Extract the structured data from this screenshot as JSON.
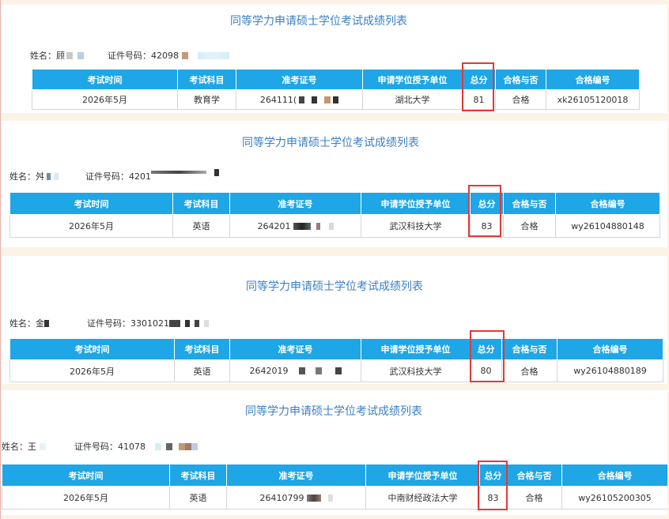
{
  "header": [
    "考试时间",
    "考试科目",
    "准考证号",
    "申请学位授予单位",
    "总分",
    "合格与否",
    "合格编号"
  ],
  "name_label": "姓名：",
  "cert_label": "证件号码：",
  "records": [
    {
      "title": "同等学力申请硕士学位考试成绩列表",
      "name_visible": "顾",
      "cert_visible": "42098",
      "exam_time": "2026年5月",
      "subject": "教育学",
      "ticket_visible": "264111(",
      "unit": "湖北大学",
      "score": "81",
      "result": "合格",
      "cert_no": "xk26105120018"
    },
    {
      "title": "同等学力申请硕士学位考试成绩列表",
      "name_visible": "舛",
      "cert_visible": "4201",
      "exam_time": "2026年5月",
      "subject": "英语",
      "ticket_visible": "264201",
      "unit": "武汉科技大学",
      "score": "83",
      "result": "合格",
      "cert_no": "wy26104880148"
    },
    {
      "title": "同等学力申请硕士学位考试成绩列表",
      "name_visible": "金",
      "cert_visible": "3301021",
      "exam_time": "2026年5月",
      "subject": "英语",
      "ticket_visible": "2642019",
      "unit": "武汉科技大学",
      "score": "80",
      "result": "合格",
      "cert_no": "wy26104880189"
    },
    {
      "title": "同等学力申请硕士学位考试成绩列表",
      "name_visible": "王",
      "cert_visible": "41078",
      "exam_time": "2026年5月",
      "subject": "英语",
      "ticket_visible": "26410799",
      "unit": "中南财经政法大学",
      "score": "83",
      "result": "合格",
      "cert_no": "wy26105200305"
    }
  ]
}
